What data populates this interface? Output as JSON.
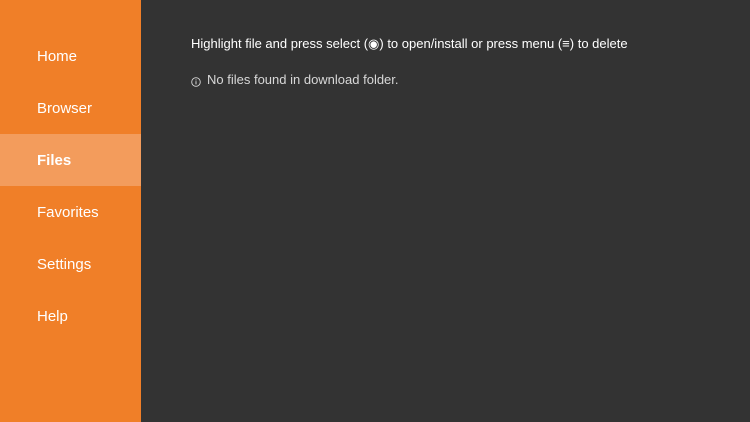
{
  "sidebar": {
    "items": [
      {
        "label": "Home",
        "active": false
      },
      {
        "label": "Browser",
        "active": false
      },
      {
        "label": "Files",
        "active": true
      },
      {
        "label": "Favorites",
        "active": false
      },
      {
        "label": "Settings",
        "active": false
      },
      {
        "label": "Help",
        "active": false
      }
    ]
  },
  "main": {
    "instructions": "Highlight file and press select (◉) to open/install or press menu (≡) to delete",
    "empty_message": "No files found in download folder.",
    "empty_icon": "info-icon"
  },
  "colors": {
    "sidebar_bg": "#f07f28",
    "sidebar_active_bg": "#f39c5c",
    "main_bg": "#333333"
  }
}
